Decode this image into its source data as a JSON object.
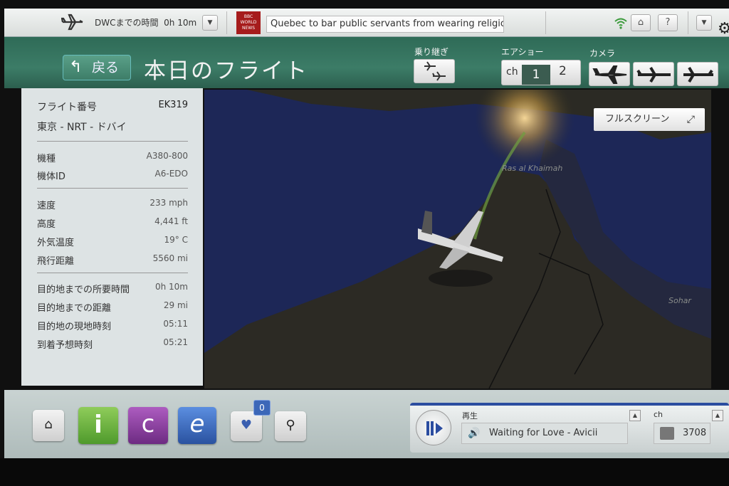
{
  "topbar": {
    "dwc_time_label": "DWCまでの時間",
    "dwc_time_value": "0h 10m",
    "news_logo_text": "BBC WORLD NEWS",
    "news_ticker": "Quebec to bar public servants from wearing religious sy"
  },
  "header": {
    "back_label": "戻る",
    "title": "本日のフライト",
    "transfer_label": "乗り継ぎ",
    "airshow_label": "エアショー",
    "channel_prefix": "ch",
    "channel_1": "1",
    "channel_2": "2",
    "camera_label": "カメラ"
  },
  "flight": {
    "number_label": "フライト番号",
    "number": "EK319",
    "route": "東京 - NRT - ドバイ",
    "details": [
      {
        "label": "機種",
        "value": "A380-800"
      },
      {
        "label": "機体ID",
        "value": "A6-EDO"
      }
    ],
    "metrics": [
      {
        "label": "速度",
        "value": "233 mph"
      },
      {
        "label": "高度",
        "value": "4,441 ft"
      },
      {
        "label": "外気温度",
        "value": "19° C"
      },
      {
        "label": "飛行距離",
        "value": "5560 mi"
      }
    ],
    "destination": [
      {
        "label": "目的地までの所要時間",
        "value": "0h 10m"
      },
      {
        "label": "目的地までの距離",
        "value": "29 mi"
      },
      {
        "label": "目的地の現地時刻",
        "value": "05:11"
      },
      {
        "label": "到着予想時刻",
        "value": "05:21"
      }
    ]
  },
  "map": {
    "fullscreen_label": "フルスクリーン",
    "places": [
      "Ras al Khaimah",
      "Sohar"
    ]
  },
  "bottom": {
    "favorites_count": "0",
    "player_status": "再生",
    "track": "Waiting for Love - Avicii",
    "channel_label": "ch",
    "channel_number": "3708"
  },
  "colors": {
    "header_green": "#3c7c67",
    "channel_active": "#3b5c50",
    "player_accent": "#2b4da0",
    "i_button": "#6fae3a",
    "c_button": "#8a3c9c",
    "e_button": "#2f5fb3"
  }
}
